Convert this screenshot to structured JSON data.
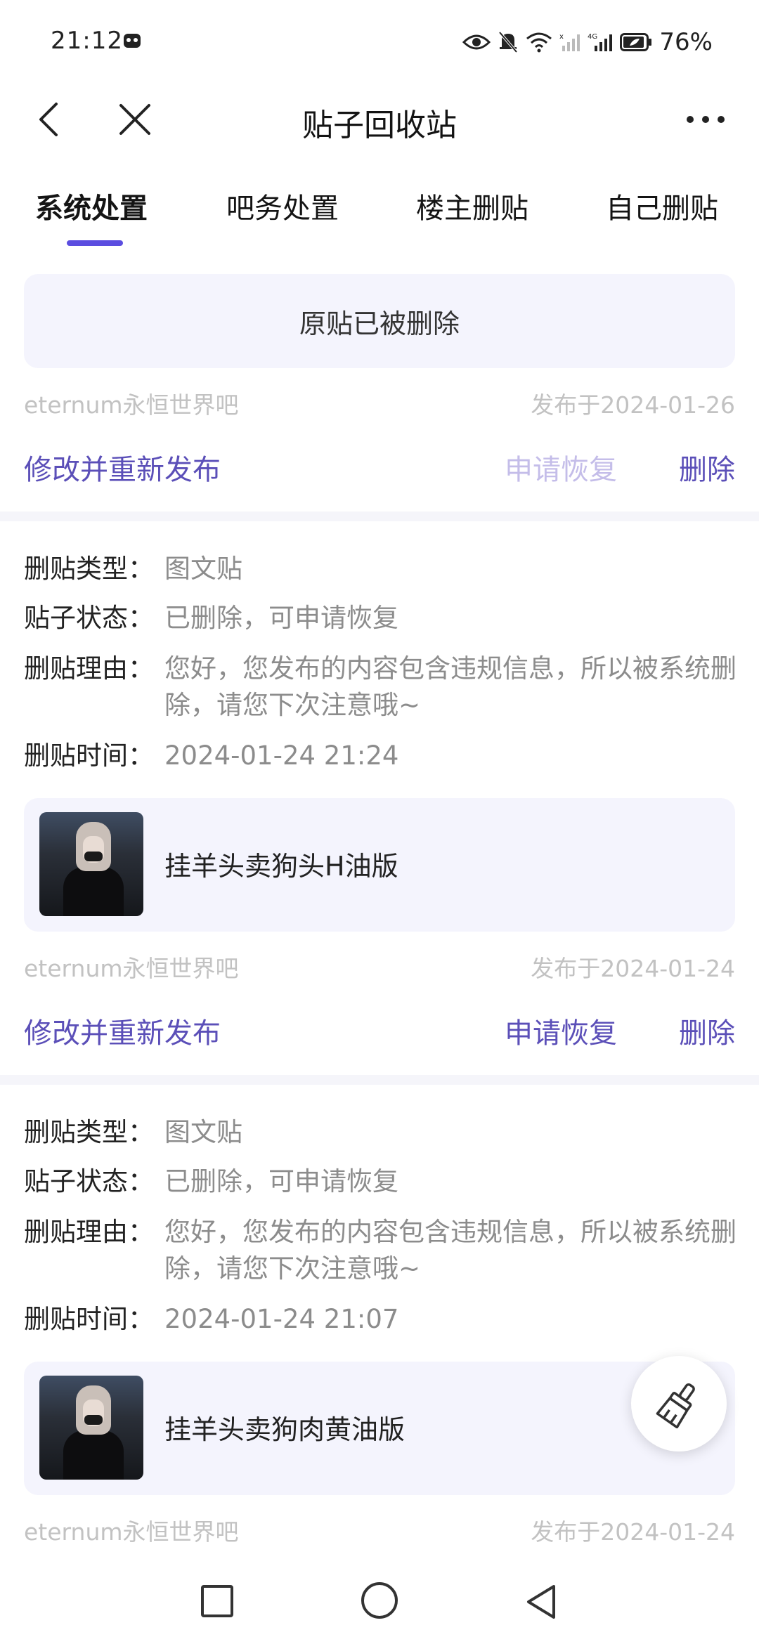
{
  "status_bar": {
    "time": "21:12",
    "network": "4G",
    "battery": "76%"
  },
  "navbar": {
    "title": "贴子回收站"
  },
  "tabs": [
    {
      "label": "系统处置",
      "active": true
    },
    {
      "label": "吧务处置",
      "active": false
    },
    {
      "label": "楼主删贴",
      "active": false
    },
    {
      "label": "自己删贴",
      "active": false
    }
  ],
  "labels": {
    "type": "删贴类型：",
    "status": "贴子状态：",
    "reason": "删贴理由：",
    "time": "删贴时间："
  },
  "actions": {
    "edit": "修改并重新发布",
    "restore": "申请恢复",
    "delete": "删除"
  },
  "posts": [
    {
      "deleted_notice": "原贴已被删除",
      "forum": "eternum永恒世界吧",
      "published": "发布于2024-01-26"
    },
    {
      "type": "图文贴",
      "status": "已删除，可申请恢复",
      "reason": "您好，您发布的内容包含违规信息，所以被系统删除，请您下次注意哦~",
      "time": "2024-01-24 21:24",
      "title": "挂羊头卖狗头H油版",
      "forum": "eternum永恒世界吧",
      "published": "发布于2024-01-24"
    },
    {
      "type": "图文贴",
      "status": "已删除，可申请恢复",
      "reason": "您好，您发布的内容包含违规信息，所以被系统删除，请您下次注意哦~",
      "time": "2024-01-24 21:07",
      "title": "挂羊头卖狗肉黄油版",
      "forum": "eternum永恒世界吧",
      "published": "发布于2024-01-24"
    }
  ],
  "colors": {
    "accent": "#5b4de0",
    "link": "#5b4fb8",
    "card_bg": "#f4f4fd"
  },
  "icons": {
    "fab": "broom-icon"
  }
}
